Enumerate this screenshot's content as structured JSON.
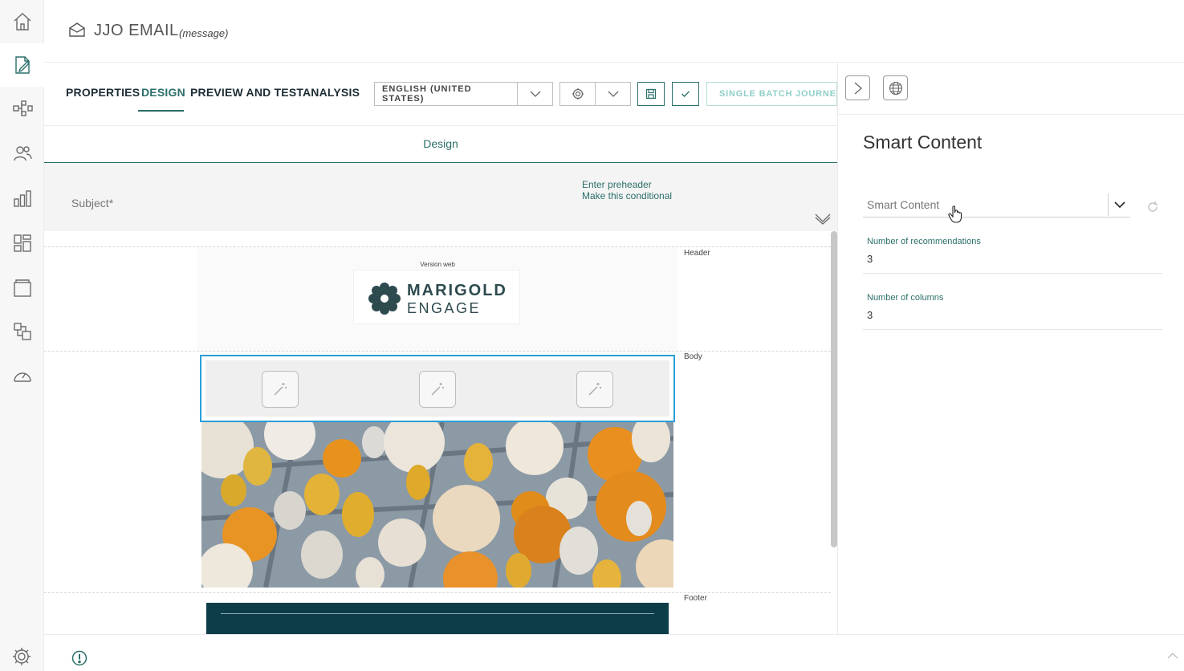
{
  "header": {
    "title": "JJO EMAIL",
    "subtitle": "(message)"
  },
  "tabs": [
    {
      "label": "PROPERTIES",
      "active": false
    },
    {
      "label": "DESIGN",
      "active": true
    },
    {
      "label": "PREVIEW AND TEST",
      "active": false
    },
    {
      "label": "ANALYSIS",
      "active": false
    }
  ],
  "toolbar": {
    "language": "ENGLISH (UNITED STATES)",
    "batch_label": "SINGLE BATCH JOURNEY"
  },
  "design": {
    "heading": "Design",
    "subject_placeholder": "Subject*",
    "preheader_link": "Enter preheader",
    "conditional_link": "Make this conditional"
  },
  "email": {
    "sections": {
      "header": "Header",
      "body": "Body",
      "footer": "Footer"
    },
    "version_web": "Version web",
    "logo_line1": "MARIGOLD",
    "logo_line2": "ENGAGE",
    "smart_content_cells": 3
  },
  "panel": {
    "title": "Smart Content",
    "select_value": "Smart Content",
    "fields": [
      {
        "label": "Number of recommendations",
        "value": "3"
      },
      {
        "label": "Number of columns",
        "value": "3"
      }
    ]
  },
  "colors": {
    "accent": "#2b6f6a",
    "selection": "#2b9fd8",
    "footer": "#0e3d4a",
    "batch_text": "#8fcfc8"
  }
}
